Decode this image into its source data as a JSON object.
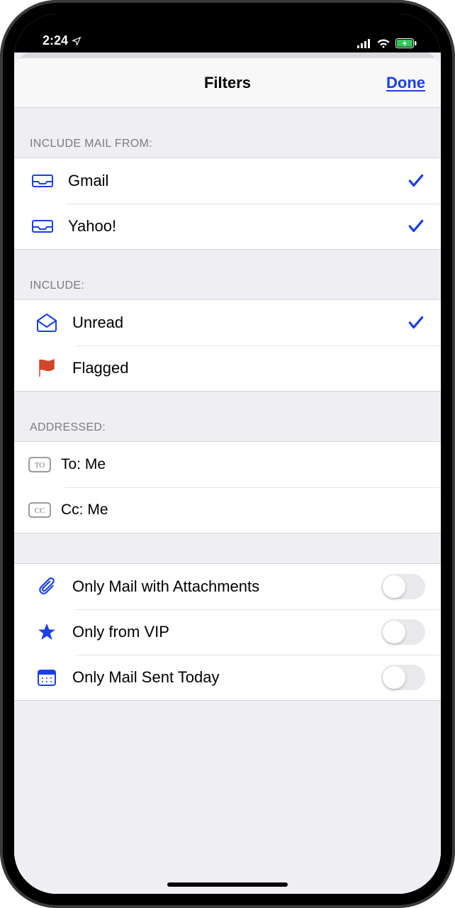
{
  "status": {
    "time": "2:24"
  },
  "nav": {
    "title": "Filters",
    "done": "Done"
  },
  "sections": {
    "include_from": {
      "header": "Include Mail From:",
      "gmail": "Gmail",
      "yahoo": "Yahoo!"
    },
    "include": {
      "header": "Include:",
      "unread": "Unread",
      "flagged": "Flagged"
    },
    "addressed": {
      "header": "Addressed:",
      "to": "To: Me",
      "cc": "Cc: Me"
    },
    "other": {
      "attachments": "Only Mail with Attachments",
      "vip": "Only from VIP",
      "today": "Only Mail Sent Today"
    }
  }
}
